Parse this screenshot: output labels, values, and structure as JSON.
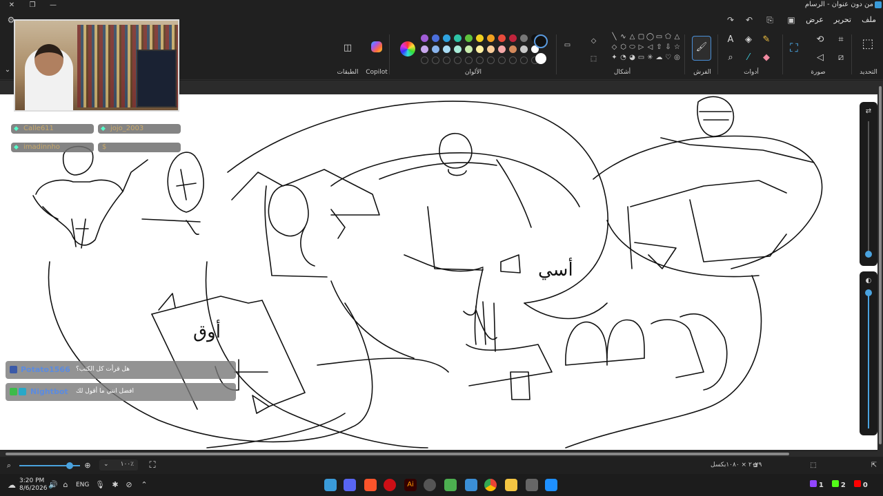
{
  "window": {
    "title": "من دون عنوان - الرسام"
  },
  "menu": {
    "file": "ملف",
    "edit": "تحرير",
    "view": "عرض"
  },
  "ribbon": {
    "selection_label": "التحديد",
    "image_label": "صورة",
    "tools_label": "أدوات",
    "brushes_label": "الفرش",
    "shapes_label": "أشكال",
    "colors_label": "الألوان",
    "copilot_label": "Copilot",
    "layers_label": "الطبقات",
    "palette_row1": [
      "#a05cd6",
      "#4b6fdc",
      "#2fa3e0",
      "#2ec4a6",
      "#5ec23c",
      "#f0d020",
      "#f0a020",
      "#e84b3c",
      "#c0243c",
      "#777777",
      "#111111"
    ],
    "palette_row2": [
      "#c8a8ec",
      "#8ab4ec",
      "#a8dcf4",
      "#a8ecd8",
      "#c8ecac",
      "#fff0a0",
      "#f8cc98",
      "#f4a8a8",
      "#d48a5c",
      "#c8c8c8",
      "#ffffff"
    ],
    "shape_glyphs": [
      "╲",
      "∿",
      "△",
      "▢",
      "◯",
      "▭",
      "⬠",
      "△",
      "◇",
      "⬡",
      "⬭",
      "▷",
      "◁",
      "⇧",
      "⇩",
      "☆",
      "✦",
      "◔",
      "◕",
      "▭",
      "✳",
      "☁",
      "♡",
      "◎"
    ]
  },
  "overlay": {
    "chat_users": [
      "Calle611",
      "jojo_2003",
      "imadinnho",
      "$"
    ],
    "messages": [
      {
        "user": "Potato1566",
        "text": "هل قرأت كل الكتب؟"
      },
      {
        "user": "Nightbot",
        "text": "افضل انني ما أقول لك"
      }
    ]
  },
  "statusbar": {
    "zoom": "١٠٠٪",
    "canvas_size": "٢٠٧٩ × ١٠٨٠بكسل"
  },
  "taskbar": {
    "time": "3:20 PM",
    "date": "8/6/2026",
    "lang": "ENG",
    "badges": [
      {
        "label": "1",
        "color": "#9146ff"
      },
      {
        "label": "2",
        "color": "#53fc18"
      },
      {
        "label": "0",
        "color": "#ff0000"
      }
    ]
  },
  "canvas_text": {
    "word1": "أوق",
    "word2": "أسي"
  }
}
